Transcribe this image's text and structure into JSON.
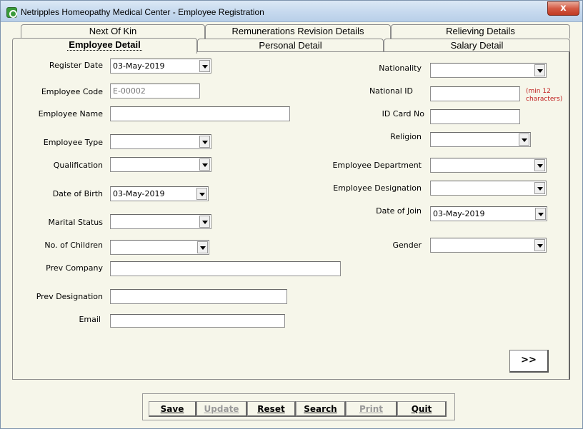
{
  "window": {
    "title": "Netripples Homeopathy Medical Center - Employee Registration",
    "close_label": "x"
  },
  "tabs_back": [
    "Next Of Kin",
    "Remunerations Revision Details",
    "Relieving Details"
  ],
  "tabs_front": [
    "Employee Detail",
    "Personal Detail",
    "Salary Detail"
  ],
  "form": {
    "register_date": {
      "label": "Register Date",
      "value": "03-May-2019"
    },
    "employee_code": {
      "label": "Employee Code",
      "value": "E-00002"
    },
    "employee_name": {
      "label": "Employee Name",
      "value": ""
    },
    "employee_type": {
      "label": "Employee Type",
      "value": ""
    },
    "qualification": {
      "label": "Qualification",
      "value": ""
    },
    "date_of_birth": {
      "label": "Date of Birth",
      "value": "03-May-2019"
    },
    "marital_status": {
      "label": "Marital Status",
      "value": ""
    },
    "no_of_children": {
      "label": "No. of Children",
      "value": ""
    },
    "prev_company": {
      "label": "Prev Company",
      "value": ""
    },
    "prev_designation": {
      "label": "Prev Designation",
      "value": ""
    },
    "email": {
      "label": "Email",
      "value": ""
    },
    "nationality": {
      "label": "Nationality",
      "value": ""
    },
    "national_id": {
      "label": "National ID",
      "value": "",
      "hint_line1": "(min 12",
      "hint_line2": "characters)"
    },
    "id_card_no": {
      "label": "ID Card No",
      "value": ""
    },
    "religion": {
      "label": "Religion",
      "value": ""
    },
    "employee_department": {
      "label": "Employee Department",
      "value": ""
    },
    "employee_designation": {
      "label": "Employee Designation",
      "value": ""
    },
    "date_of_join": {
      "label": "Date of Join",
      "value": "03-May-2019"
    },
    "gender": {
      "label": "Gender",
      "value": ""
    }
  },
  "next_label": ">>",
  "actions": {
    "save": "Save",
    "update": "Update",
    "reset": "Reset",
    "search": "Search",
    "print": "Print",
    "quit": "Quit"
  }
}
